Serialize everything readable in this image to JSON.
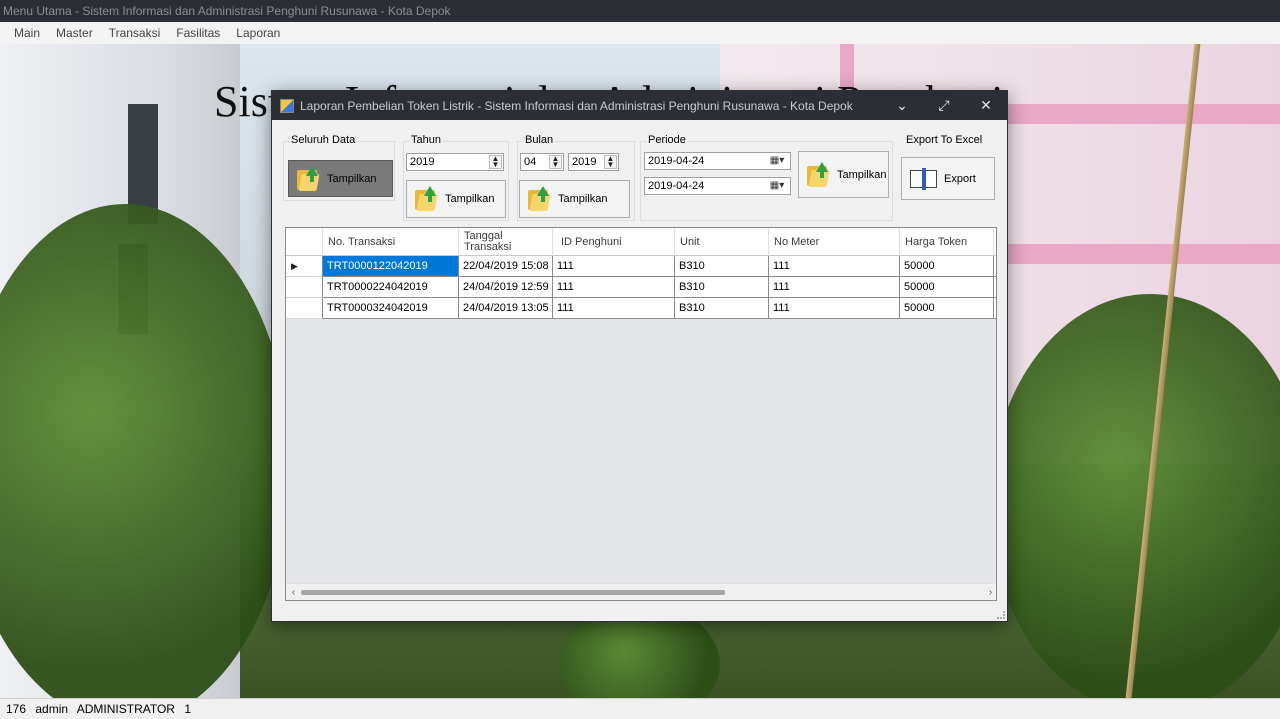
{
  "main_window": {
    "title": "Menu Utama - Sistem Informasi dan Administrasi Penghuni Rusunawa - Kota Depok",
    "menu": [
      "Main",
      "Master",
      "Transaksi",
      "Fasilitas",
      "Laporan"
    ],
    "background_heading": "Sistem Informasi dan Administrasi Penghuni"
  },
  "status_bar": {
    "id": "176",
    "user": "admin",
    "role": "ADMINISTRATOR",
    "level": "1"
  },
  "dialog": {
    "title": "Laporan Pembelian Token Listrik - Sistem Informasi dan Administrasi Penghuni Rusunawa - Kota Depok",
    "controls": {
      "minimize": "⌄",
      "maximize": "⤢",
      "close": "✕"
    },
    "seluruh_data": {
      "label": "Seluruh Data",
      "button": "Tampilkan"
    },
    "tahun": {
      "label": "Tahun",
      "value": "2019",
      "button": "Tampilkan"
    },
    "bulan": {
      "label": "Bulan",
      "month": "04",
      "year": "2019",
      "button": "Tampilkan"
    },
    "periode": {
      "label": "Periode",
      "from": "2019-04-24",
      "to": "2019-04-24",
      "button": "Tampilkan"
    },
    "export": {
      "label": "Export To Excel",
      "button": "Export"
    },
    "grid": {
      "columns": [
        "No. Transaksi",
        "Tanggal Transaksi",
        "ID Penghuni",
        "Unit",
        "No Meter",
        "Harga Token"
      ],
      "rows": [
        [
          "TRT0000122042019",
          "22/04/2019 15:08",
          "111",
          "B310",
          "111",
          "50000"
        ],
        [
          "TRT0000224042019",
          "24/04/2019 12:59",
          "111",
          "B310",
          "111",
          "50000"
        ],
        [
          "TRT0000324042019",
          "24/04/2019 13:05",
          "111",
          "B310",
          "111",
          "50000"
        ]
      ],
      "current_row_marker": "▶"
    }
  },
  "colors": {
    "titlebar": "#2b2f35",
    "selection": "#0078d7"
  }
}
